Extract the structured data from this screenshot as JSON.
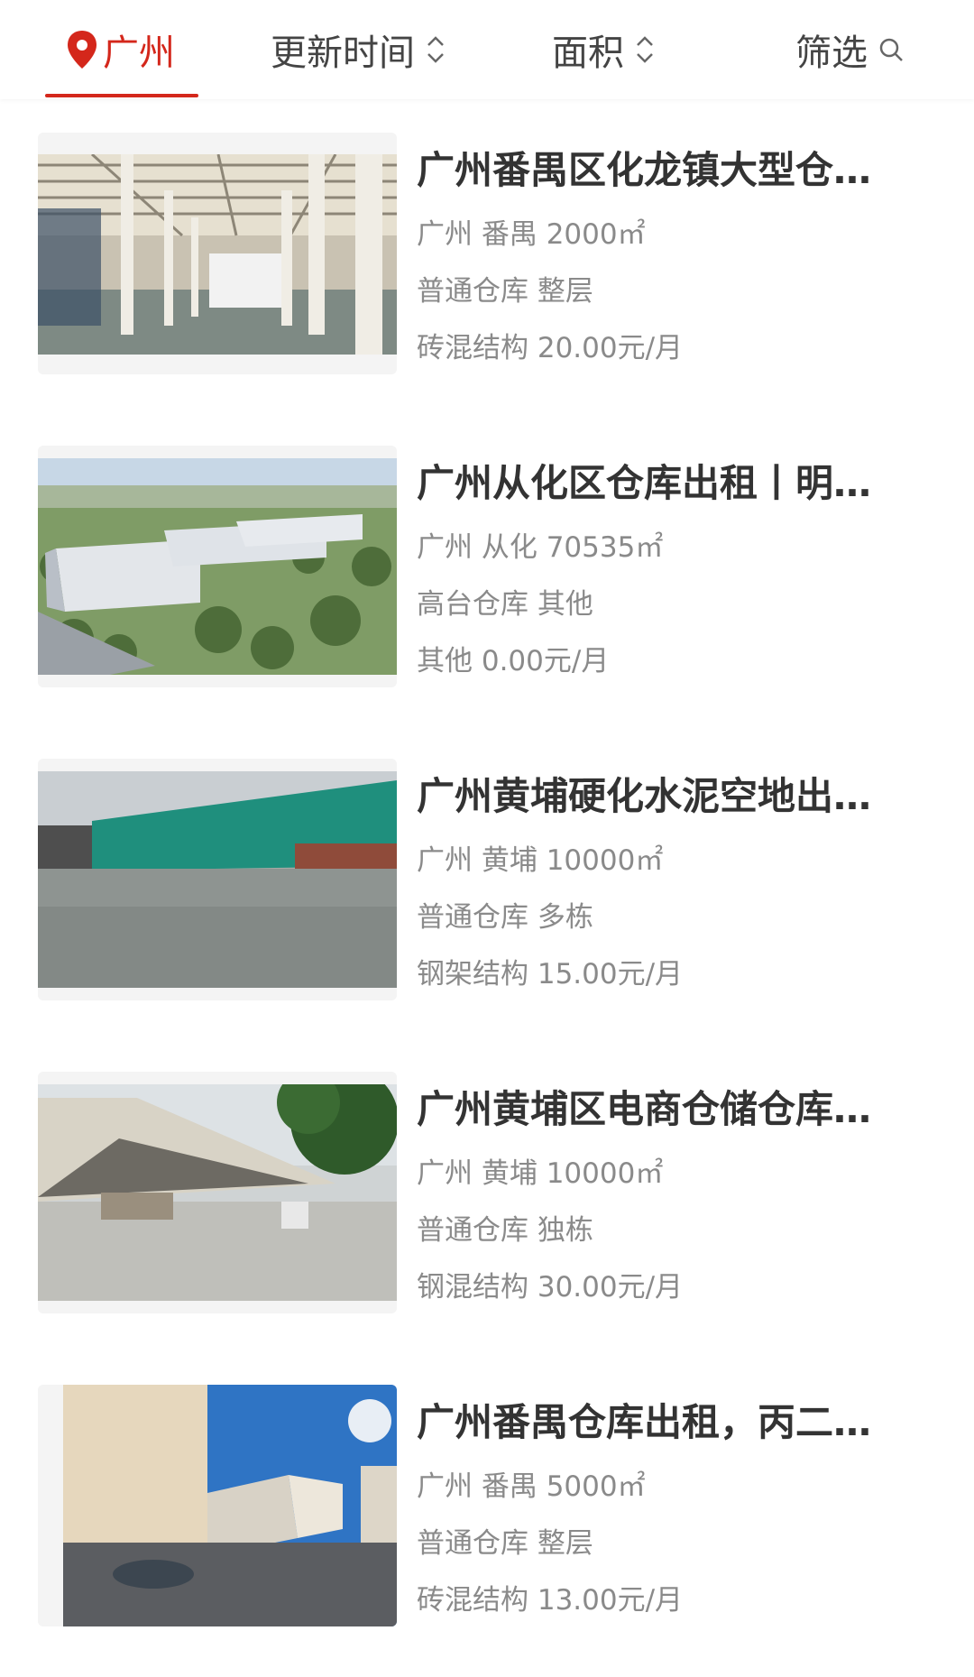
{
  "filter_bar": {
    "city": "广州",
    "update_time": "更新时间",
    "area": "面积",
    "filter": "筛选"
  },
  "listings": [
    {
      "title": "广州番禺区化龙镇大型仓…",
      "location": "广州 番禺 2000㎡",
      "type": "普通仓库 整层",
      "price": "砖混结构 20.00元/月"
    },
    {
      "title": "广州从化区仓库出租丨明…",
      "location": "广州 从化 70535㎡",
      "type": "高台仓库 其他",
      "price": "其他 0.00元/月"
    },
    {
      "title": "广州黄埔硬化水泥空地出…",
      "location": "广州 黄埔 10000㎡",
      "type": "普通仓库 多栋",
      "price": "钢架结构 15.00元/月"
    },
    {
      "title": "广州黄埔区电商仓储仓库…",
      "location": "广州 黄埔 10000㎡",
      "type": "普通仓库 独栋",
      "price": "钢混结构 30.00元/月"
    },
    {
      "title": "广州番禺仓库出租，丙二…",
      "location": "广州 番禺 5000㎡",
      "type": "普通仓库 整层",
      "price": "砖混结构 13.00元/月"
    }
  ],
  "colors": {
    "accent": "#d4271b",
    "title": "#333333",
    "meta": "#8a8a8a"
  }
}
